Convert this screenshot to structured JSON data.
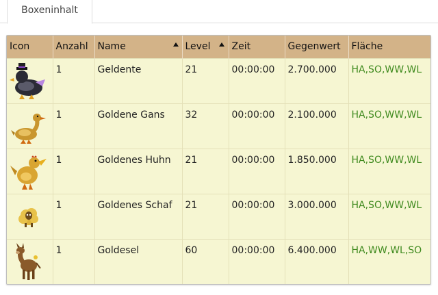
{
  "tabs": [
    {
      "label": "Boxeninhalt"
    }
  ],
  "table": {
    "headers": [
      "Icon",
      "Anzahl",
      "Name",
      "Level",
      "Zeit",
      "Gegenwert",
      "Fläche"
    ],
    "sorted_columns": [
      "Name",
      "Level"
    ],
    "rows": [
      {
        "icon": "money-duck-icon",
        "anzahl": "1",
        "name": "Geldente",
        "level": "21",
        "zeit": "00:00:00",
        "gegenwert": "2.700.000",
        "flaeche": "HA,SO,WW,WL"
      },
      {
        "icon": "golden-goose-icon",
        "anzahl": "1",
        "name": "Goldene Gans",
        "level": "32",
        "zeit": "00:00:00",
        "gegenwert": "2.100.000",
        "flaeche": "HA,SO,WW,WL"
      },
      {
        "icon": "golden-chicken-icon",
        "anzahl": "1",
        "name": "Goldenes Huhn",
        "level": "21",
        "zeit": "00:00:00",
        "gegenwert": "1.850.000",
        "flaeche": "HA,SO,WW,WL"
      },
      {
        "icon": "golden-sheep-icon",
        "anzahl": "1",
        "name": "Goldenes Schaf",
        "level": "21",
        "zeit": "00:00:00",
        "gegenwert": "3.000.000",
        "flaeche": "HA,SO,WW,WL"
      },
      {
        "icon": "gold-donkey-icon",
        "anzahl": "1",
        "name": "Goldesel",
        "level": "60",
        "zeit": "00:00:00",
        "gegenwert": "6.400.000",
        "flaeche": "HA,WW,WL,SO"
      }
    ]
  },
  "colors": {
    "header_bg": "#d3b388",
    "row_bg": "#f6f6d2",
    "flaeche_text": "#3f8a1e"
  }
}
